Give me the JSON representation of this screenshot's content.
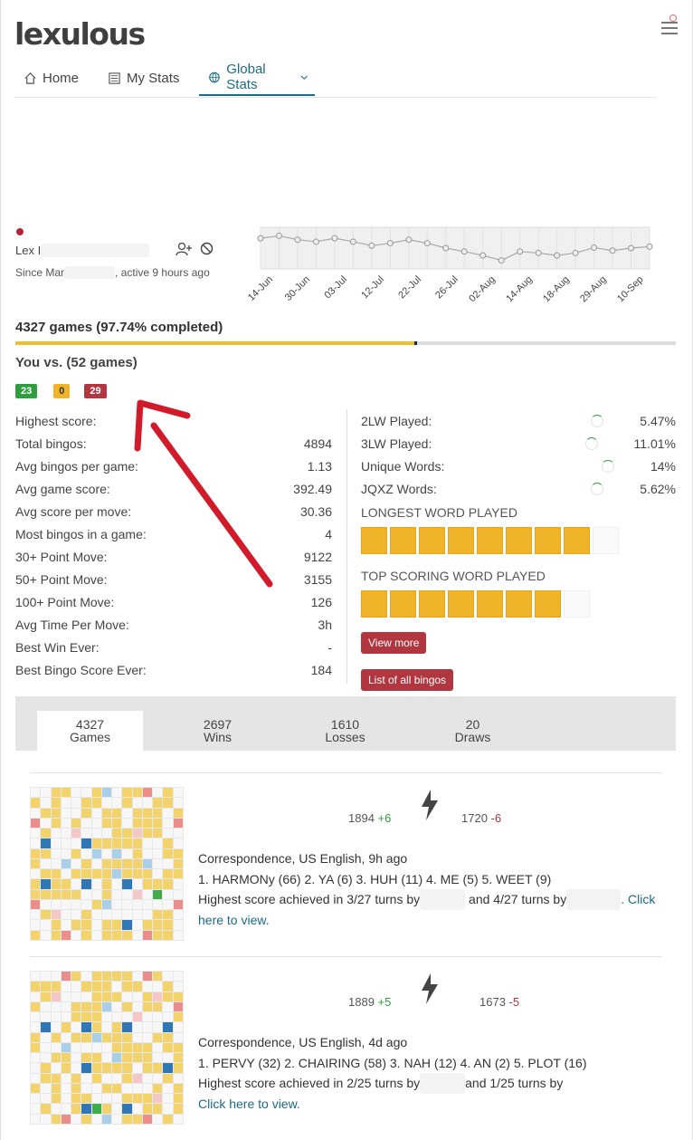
{
  "app": {
    "logo": "lexulous"
  },
  "nav": {
    "home": "Home",
    "my_stats": "My Stats",
    "global_stats": "Global Stats"
  },
  "user": {
    "name": "Lex I",
    "since": "Since Mar",
    "active": ", active 9 hours ago"
  },
  "chart_data": {
    "type": "line",
    "x": [
      "14-Jun",
      "30-Jun",
      "03-Jul",
      "12-Jul",
      "22-Jul",
      "26-Jul",
      "02-Aug",
      "14-Aug",
      "18-Aug",
      "29-Aug",
      "10-Sep"
    ],
    "values": [
      1915,
      1920,
      1912,
      1908,
      1915,
      1908,
      1900,
      1905,
      1912,
      1905,
      1895,
      1888,
      1880,
      1870,
      1888,
      1885,
      1880,
      1885,
      1896,
      1890,
      1895,
      1898
    ],
    "grid": true
  },
  "summary": {
    "games_title": "4327 games (97.74% completed)",
    "completed_fraction": 0.9774,
    "vs_title": "You vs. (52 games)",
    "wins": "23",
    "draws": "0",
    "losses": "29"
  },
  "stats_left": [
    {
      "label": "Highest score:",
      "value": ""
    },
    {
      "label": "Total bingos:",
      "value": "4894"
    },
    {
      "label": "Avg bingos per game:",
      "value": "1.13"
    },
    {
      "label": "Avg game score:",
      "value": "392.49"
    },
    {
      "label": "Avg score per move:",
      "value": "30.36"
    },
    {
      "label": "Most bingos in a game:",
      "value": "4"
    },
    {
      "label": "30+ Point Move:",
      "value": "9122"
    },
    {
      "label": "50+ Point Move:",
      "value": "3155"
    },
    {
      "label": "100+ Point Move:",
      "value": "126"
    },
    {
      "label": "Avg Time Per Move:",
      "value": "3h"
    },
    {
      "label": "Best Win Ever:",
      "value": "-"
    },
    {
      "label": "Best Bingo Score Ever:",
      "value": "184"
    }
  ],
  "stats_right": [
    {
      "label": "2LW Played:",
      "value": "5.47%"
    },
    {
      "label": "3LW Played:",
      "value": "11.01%"
    },
    {
      "label": "Unique Words:",
      "value": "14%"
    },
    {
      "label": "JQXZ Words:",
      "value": "5.62%"
    }
  ],
  "longest_word_title": "LONGEST WORD PLAYED",
  "top_scoring_title": "TOP SCORING WORD PLAYED",
  "view_more": "View more",
  "all_bingos": "List of all bingos",
  "tabs": [
    {
      "count": "4327",
      "label": "Games"
    },
    {
      "count": "2697",
      "label": "Wins"
    },
    {
      "count": "1610",
      "label": "Losses"
    },
    {
      "count": "20",
      "label": "Draws"
    }
  ],
  "games": [
    {
      "score1": "1894",
      "delta1": "+6",
      "score2": "1720",
      "delta2": "-6",
      "type": "Correspondence, US English, 9h ago",
      "words": "1. HARMONy (66) 2. YA (6) 3. HUH (11) 4. ME (5) 5. WEET (9)",
      "highest": "Highest score achieved in 3/27 turns by",
      "highest2": "and 4/27 turns by",
      "click": ". Click here to view."
    },
    {
      "score1": "1889",
      "delta1": "+5",
      "score2": "1673",
      "delta2": "-5",
      "type": "Correspondence, US English, 4d ago",
      "words": "1. PERVY (32) 2. CHAIRING (58) 3. NAH (12) 4. AN (2) 5. PLOT (16)",
      "highest": "Highest score achieved in 2/25 turns by",
      "highest2": "and 1/25 turns by",
      "click": "Click here to view."
    }
  ]
}
